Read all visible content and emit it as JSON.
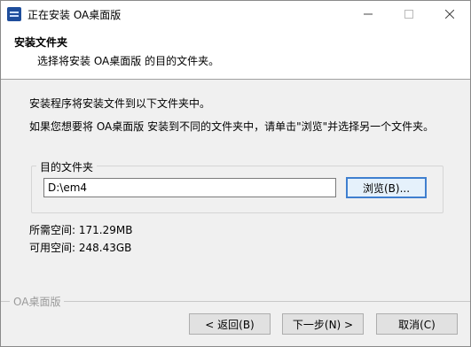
{
  "window": {
    "title": "正在安装 OA桌面版",
    "icon": "installer-app-icon"
  },
  "header": {
    "title": "安装文件夹",
    "subtitle": "选择将安装 OA桌面版 的目的文件夹。"
  },
  "content": {
    "intro_line1": "安装程序将安装文件到以下文件夹中。",
    "intro_line2": "如果您想要将 OA桌面版 安装到不同的文件夹中，请单击\"浏览\"并选择另一个文件夹。",
    "destination_group_label": "目的文件夹",
    "destination_path": "D:\\em4",
    "browse_label": "浏览(B)...",
    "space_required": "所需空间: 171.29MB",
    "space_available": "可用空间: 248.43GB"
  },
  "footer": {
    "brand": "OA桌面版",
    "back_label": "< 返回(B)",
    "next_label": "下一步(N) >",
    "cancel_label": "取消(C)"
  },
  "colors": {
    "focus_border": "#3f7fcf",
    "dialog_bg": "#f0f0f0",
    "brand_text": "#9a9a9a"
  }
}
